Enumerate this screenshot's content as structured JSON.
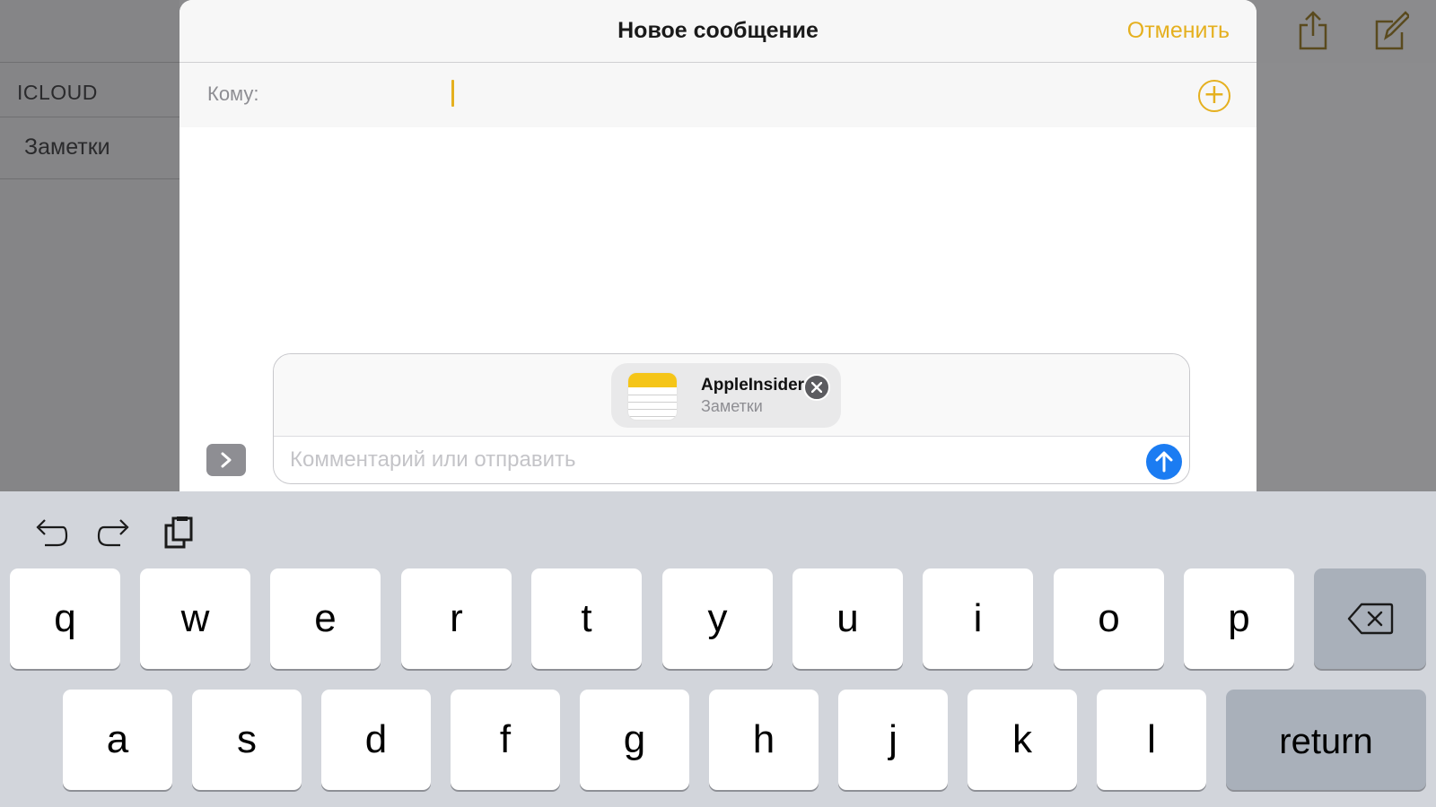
{
  "background": {
    "sidebar_section": "ICLOUD",
    "sidebar_folder": "Заметки",
    "toolbar_icons": [
      "share-icon",
      "compose-icon"
    ]
  },
  "compose": {
    "title": "Новое сообщение",
    "cancel_label": "Отменить",
    "to_label": "Кому:",
    "to_value": "",
    "add_recipient_icon": "plus-circle-icon",
    "attachment": {
      "title": "AppleInsider",
      "subtitle": "Заметки",
      "icon": "notes-app-icon"
    },
    "comment_placeholder": "Комментарий или отправить",
    "send_icon": "arrow-up-icon",
    "expand_icon": "chevron-right-icon"
  },
  "keyboard": {
    "toolbar": [
      "undo-icon",
      "redo-icon",
      "paste-icon"
    ],
    "row1": [
      "q",
      "w",
      "e",
      "r",
      "t",
      "y",
      "u",
      "i",
      "o",
      "p"
    ],
    "row2": [
      "a",
      "s",
      "d",
      "f",
      "g",
      "h",
      "j",
      "k",
      "l"
    ],
    "backspace_icon": "backspace-icon",
    "return_label": "return"
  },
  "colors": {
    "accent": "#e5b01f",
    "send": "#1b7cf2",
    "keyboard_bg": "#d2d5db"
  }
}
